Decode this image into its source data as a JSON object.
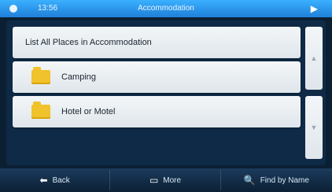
{
  "status_bar": {
    "time": "13:56",
    "title": "Accommodation"
  },
  "list": {
    "header_item": "List All Places in Accommodation",
    "items": [
      {
        "label": "Camping",
        "icon": "folder-icon"
      },
      {
        "label": "Hotel or Motel",
        "icon": "folder-icon"
      }
    ]
  },
  "scroll": {
    "up_glyph": "▲",
    "down_glyph": "▼"
  },
  "bottom_bar": {
    "back": {
      "label": "Back",
      "icon": "back-arrow-icon"
    },
    "more": {
      "label": "More",
      "icon": "more-icon"
    },
    "find": {
      "label": "Find by Name",
      "icon": "search-icon"
    }
  },
  "colors": {
    "status_bar": "#2a97f0",
    "background": "#0b1f33",
    "folder": "#f0c22b"
  }
}
